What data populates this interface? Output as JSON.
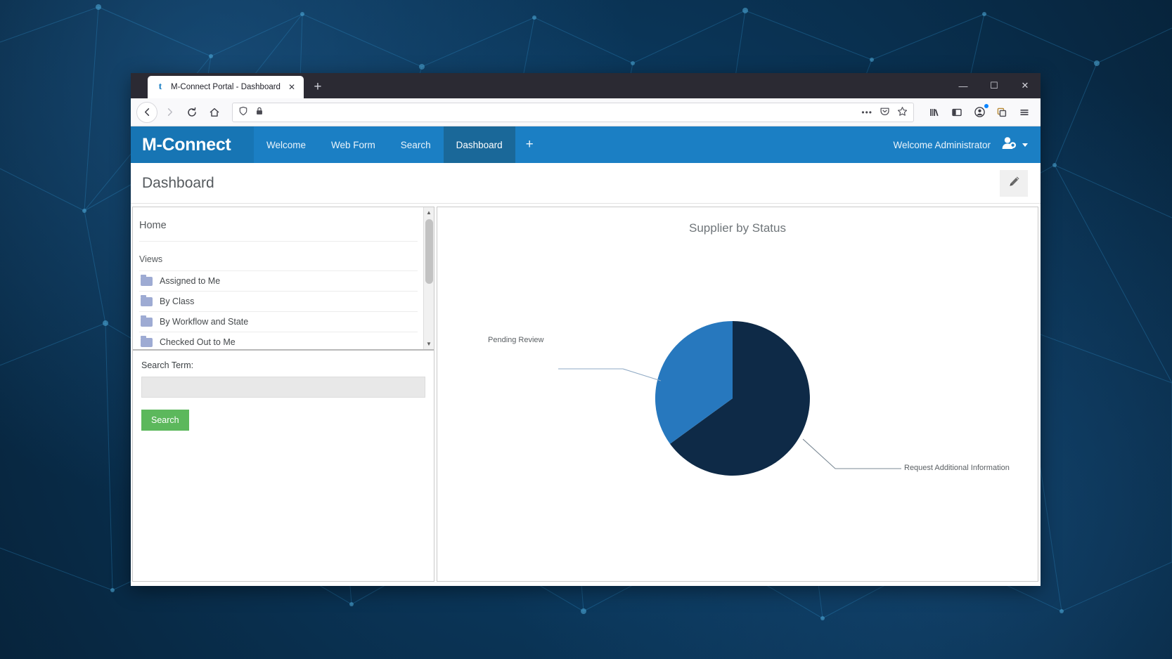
{
  "window": {
    "tab_title": "M-Connect Portal - Dashboard",
    "favicon_glyph": "t",
    "close_tab_glyph": "✕",
    "new_tab_glyph": "+",
    "minimize_glyph": "—",
    "maximize_glyph": "☐",
    "close_glyph": "✕"
  },
  "browser": {
    "back_glyph": "←",
    "forward_glyph": "→",
    "reload_glyph": "↻",
    "home_glyph": "⌂",
    "url_value": "",
    "url_placeholder": "",
    "page_actions_glyph": "•••",
    "pocket_glyph": "ἒF",
    "bookmark_glyph": "☆",
    "library_glyph": "‖",
    "sidebar_glyph": "▧",
    "account_glyph": "●",
    "container_glyph": "⧉",
    "menu_glyph": "≡"
  },
  "app": {
    "brand": "M-Connect",
    "nav_items": [
      {
        "label": "Welcome",
        "active": false
      },
      {
        "label": "Web Form",
        "active": false
      },
      {
        "label": "Search",
        "active": false
      },
      {
        "label": "Dashboard",
        "active": true
      }
    ],
    "add_tab_label": "+",
    "welcome_text": "Welcome Administrator",
    "page_title": "Dashboard",
    "edit_button_label": ""
  },
  "sidebar": {
    "home_label": "Home",
    "section_label": "Views",
    "items": [
      {
        "label": "Assigned to Me"
      },
      {
        "label": "By Class"
      },
      {
        "label": "By Workflow and State"
      },
      {
        "label": "Checked Out to Me"
      }
    ],
    "scroll_up_glyph": "▲",
    "scroll_down_glyph": "▼"
  },
  "search": {
    "label": "Search Term:",
    "value": "",
    "placeholder": "",
    "button_label": "Search"
  },
  "colors": {
    "brand_blue": "#1b7fc4",
    "brand_blue_dark": "#1a6899",
    "search_green": "#5cb85c",
    "slice_navy": "#0e2a47",
    "slice_blue": "#2778be"
  },
  "chart_data": {
    "type": "pie",
    "title": "Supplier by Status",
    "labels": [
      "Request Additional Information",
      "Pending Review"
    ],
    "values": [
      65,
      35
    ],
    "colors": [
      "#0e2a47",
      "#2778be"
    ],
    "legend": "none",
    "annotations": [
      {
        "text": "Pending Review",
        "position": "left"
      },
      {
        "text": "Request Additional Information",
        "position": "right"
      }
    ]
  }
}
